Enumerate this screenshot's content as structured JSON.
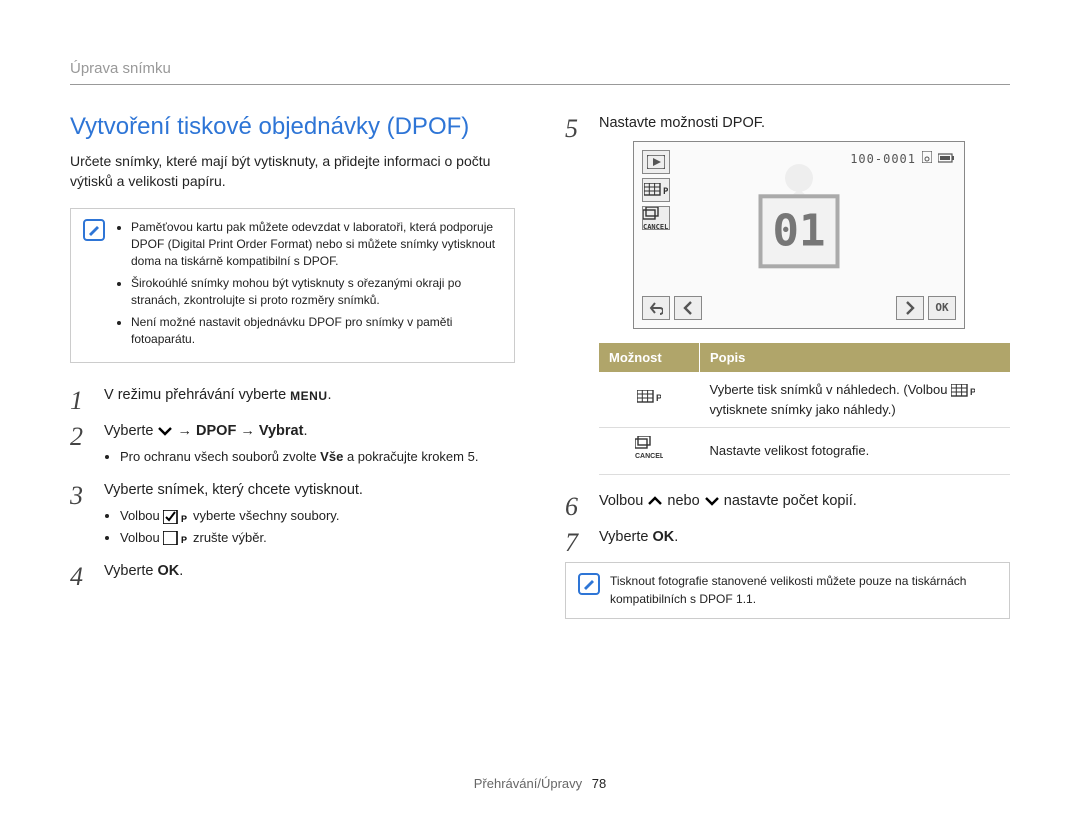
{
  "header": {
    "breadcrumb": "Úprava snímku"
  },
  "title": "Vytvoření tiskové objednávky (DPOF)",
  "intro": "Určete snímky, které mají být vytisknuty, a přidejte informaci o počtu výtisků a velikosti papíru.",
  "note1": {
    "items": [
      "Paměťovou kartu pak můžete odevzdat v laboratoři, která podporuje DPOF (Digital Print Order Format) nebo si můžete snímky vytisknout doma na tiskárně kompatibilní s DPOF.",
      "Širokoúhlé snímky mohou být vytisknuty s ořezanými okraji po stranách, zkontrolujte si proto rozměry snímků.",
      "Není možné nastavit objednávku DPOF pro snímky v paměti fotoaparátu."
    ]
  },
  "steps_left": {
    "s1_pre": "V režimu přehrávání vyberte ",
    "s1_icon_label": "MENU",
    "s1_post": ".",
    "s2_pre": "Vyberte ",
    "s2_mid": " → DPOF → Vybrat",
    "s2_post": ".",
    "s2_sub_pre": "Pro ochranu všech souborů zvolte ",
    "s2_sub_bold": "Vše",
    "s2_sub_post": " a pokračujte krokem 5.",
    "s3": "Vyberte snímek, který chcete vytisknout.",
    "s3_sub1_pre": "Volbou ",
    "s3_sub1_post": " vyberte všechny soubory.",
    "s3_sub2_pre": "Volbou ",
    "s3_sub2_post": " zrušte výběr.",
    "s4_pre": "Vyberte ",
    "s4_ok": "OK",
    "s4_post": "."
  },
  "steps_right": {
    "s5": "Nastavte možnosti DPOF.",
    "s6_pre": "Volbou ",
    "s6_mid": " nebo ",
    "s6_post": " nastavte počet kopií.",
    "s7_pre": "Vyberte ",
    "s7_ok": "OK",
    "s7_post": "."
  },
  "lcd": {
    "counter": "100-0001",
    "big": "01",
    "ok": "OK"
  },
  "table": {
    "h1": "Možnost",
    "h2": "Popis",
    "row1_pre": "Vyberte tisk snímků v náhledech. (Volbou ",
    "row1_post": " vytisknete snímky jako náhledy.)",
    "row2": "Nastavte velikost fotografie."
  },
  "note2": "Tisknout fotografie stanovené velikosti můžete pouze na tiskárnách kompatibilních s DPOF 1.1.",
  "footer": {
    "section": "Přehrávání/Úpravy",
    "page": "78"
  },
  "icons": {
    "pencil": "pencil-icon",
    "grid": "grid-icon",
    "size_cancel": "size-cancel-icon",
    "menu": "menu-icon",
    "ok": "ok-icon",
    "down": "chevron-down-icon",
    "up": "chevron-up-icon",
    "checkbox_checked": "checkbox-checked-icon",
    "checkbox_empty": "checkbox-empty-icon",
    "play": "play-button-icon",
    "back": "back-icon",
    "left": "chevron-left-icon",
    "right": "chevron-right-icon",
    "battery": "battery-icon",
    "disk": "storage-icon"
  }
}
